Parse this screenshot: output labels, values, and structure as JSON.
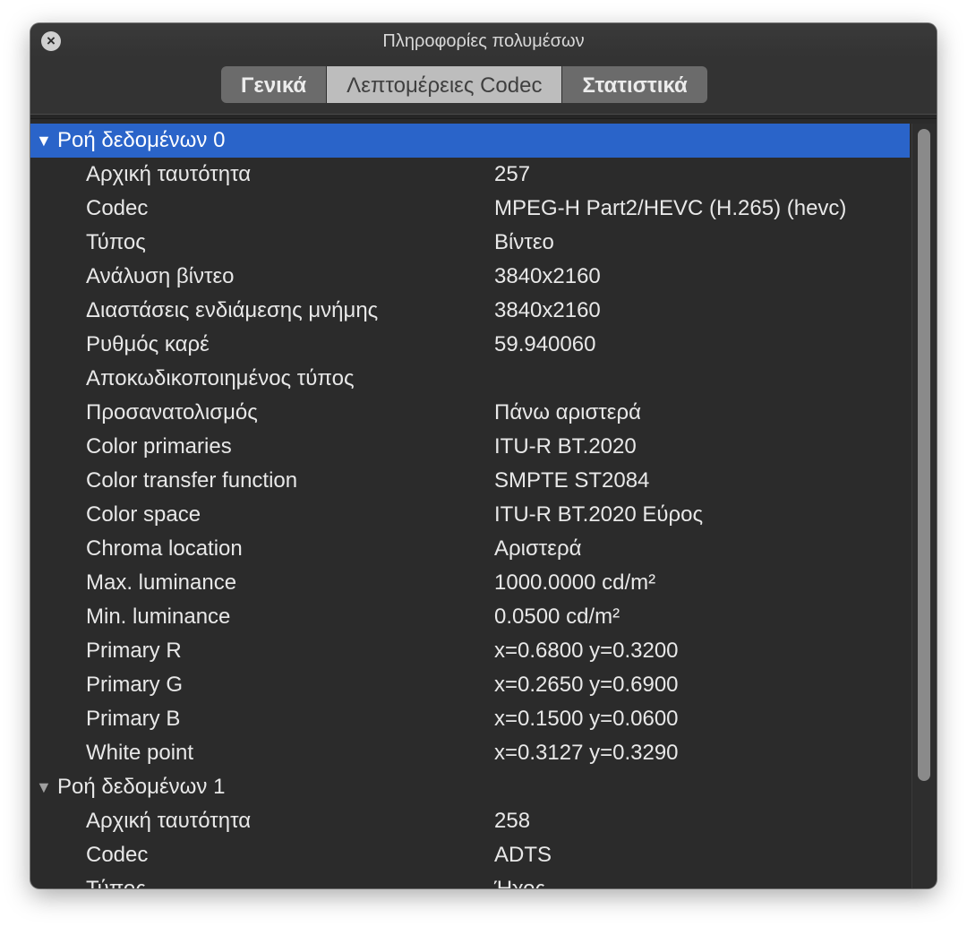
{
  "window": {
    "title": "Πληροφορίες πολυμέσων",
    "close_icon": "×"
  },
  "tabs": [
    {
      "label": "Γενικά",
      "active": false
    },
    {
      "label": "Λεπτομέρειες Codec",
      "active": true
    },
    {
      "label": "Στατιστικά",
      "active": false
    }
  ],
  "streams": [
    {
      "header": "Ροή δεδομένων 0",
      "expanded_icon": "▼",
      "selected": true,
      "properties": [
        {
          "label": "Αρχική ταυτότητα",
          "value": "257"
        },
        {
          "label": "Codec",
          "value": "MPEG-H Part2/HEVC (H.265) (hevc)"
        },
        {
          "label": "Τύπος",
          "value": "Βίντεο"
        },
        {
          "label": "Ανάλυση βίντεο",
          "value": "3840x2160"
        },
        {
          "label": "Διαστάσεις ενδιάμεσης μνήμης",
          "value": "3840x2160"
        },
        {
          "label": "Ρυθμός καρέ",
          "value": "59.940060"
        },
        {
          "label": "Αποκωδικοποιημένος τύπος",
          "value": ""
        },
        {
          "label": "Προσανατολισμός",
          "value": "Πάνω αριστερά"
        },
        {
          "label": "Color primaries",
          "value": "ITU-R BT.2020"
        },
        {
          "label": "Color transfer function",
          "value": "SMPTE ST2084"
        },
        {
          "label": "Color space",
          "value": "ITU-R BT.2020 Εύρος"
        },
        {
          "label": "Chroma location",
          "value": "Αριστερά"
        },
        {
          "label": "Max. luminance",
          "value": "1000.0000 cd/m²"
        },
        {
          "label": "Min. luminance",
          "value": "0.0500 cd/m²"
        },
        {
          "label": "Primary R",
          "value": "x=0.6800 y=0.3200"
        },
        {
          "label": "Primary G",
          "value": "x=0.2650 y=0.6900"
        },
        {
          "label": "Primary B",
          "value": "x=0.1500 y=0.0600"
        },
        {
          "label": "White point",
          "value": "x=0.3127 y=0.3290"
        }
      ]
    },
    {
      "header": "Ροή δεδομένων 1",
      "expanded_icon": "▼",
      "selected": false,
      "properties": [
        {
          "label": "Αρχική ταυτότητα",
          "value": "258"
        },
        {
          "label": "Codec",
          "value": "ADTS"
        },
        {
          "label": "Τύπος",
          "value": "Ήχος"
        }
      ]
    }
  ],
  "colors": {
    "selection": "#2a64c9",
    "window_bg": "#2b2b2b",
    "text": "#e8e8e8"
  },
  "scrollbar": {
    "visible_fraction": 0.86
  }
}
